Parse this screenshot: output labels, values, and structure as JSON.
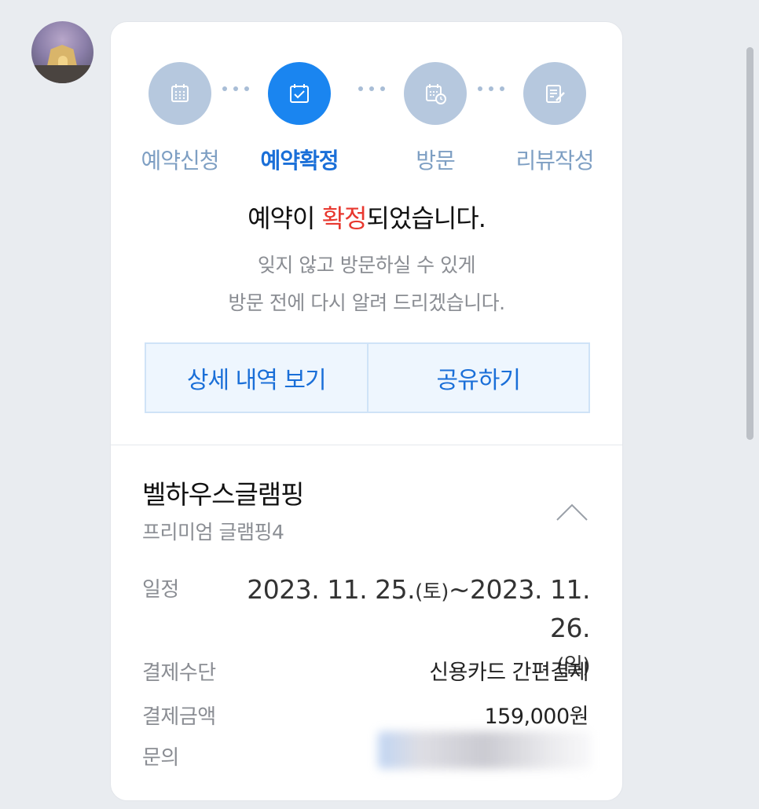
{
  "steps": [
    {
      "label": "예약신청",
      "icon": "calendar-icon",
      "active": false
    },
    {
      "label": "예약확정",
      "icon": "calendar-check-icon",
      "active": true
    },
    {
      "label": "방문",
      "icon": "calendar-clock-icon",
      "active": false
    },
    {
      "label": "리뷰작성",
      "icon": "review-edit-icon",
      "active": false
    }
  ],
  "headline": {
    "before": "예약이 ",
    "highlight": "확정",
    "after": "되었습니다."
  },
  "subtext": {
    "line1": "잊지 않고 방문하실 수 있게",
    "line2": "방문 전에 다시 알려 드리겠습니다."
  },
  "buttons": {
    "details": "상세 내역 보기",
    "share": "공유하기"
  },
  "booking": {
    "place": "벨하우스글램핑",
    "room": "프리미엄 글램핑4",
    "schedule_label": "일정",
    "schedule_start": "2023. 11. 25.",
    "schedule_start_day": "(토)",
    "schedule_sep": "~",
    "schedule_end": "2023. 11. 26.",
    "schedule_end_day": "(일)",
    "payment_method_label": "결제수단",
    "payment_method": "신용카드 간편결제",
    "amount_label": "결제금액",
    "amount": "159,000원",
    "inquiry_label": "문의"
  },
  "colors": {
    "accent": "#1a85f0",
    "highlight": "#e8382f",
    "inactive_step": "#b6c8de"
  }
}
